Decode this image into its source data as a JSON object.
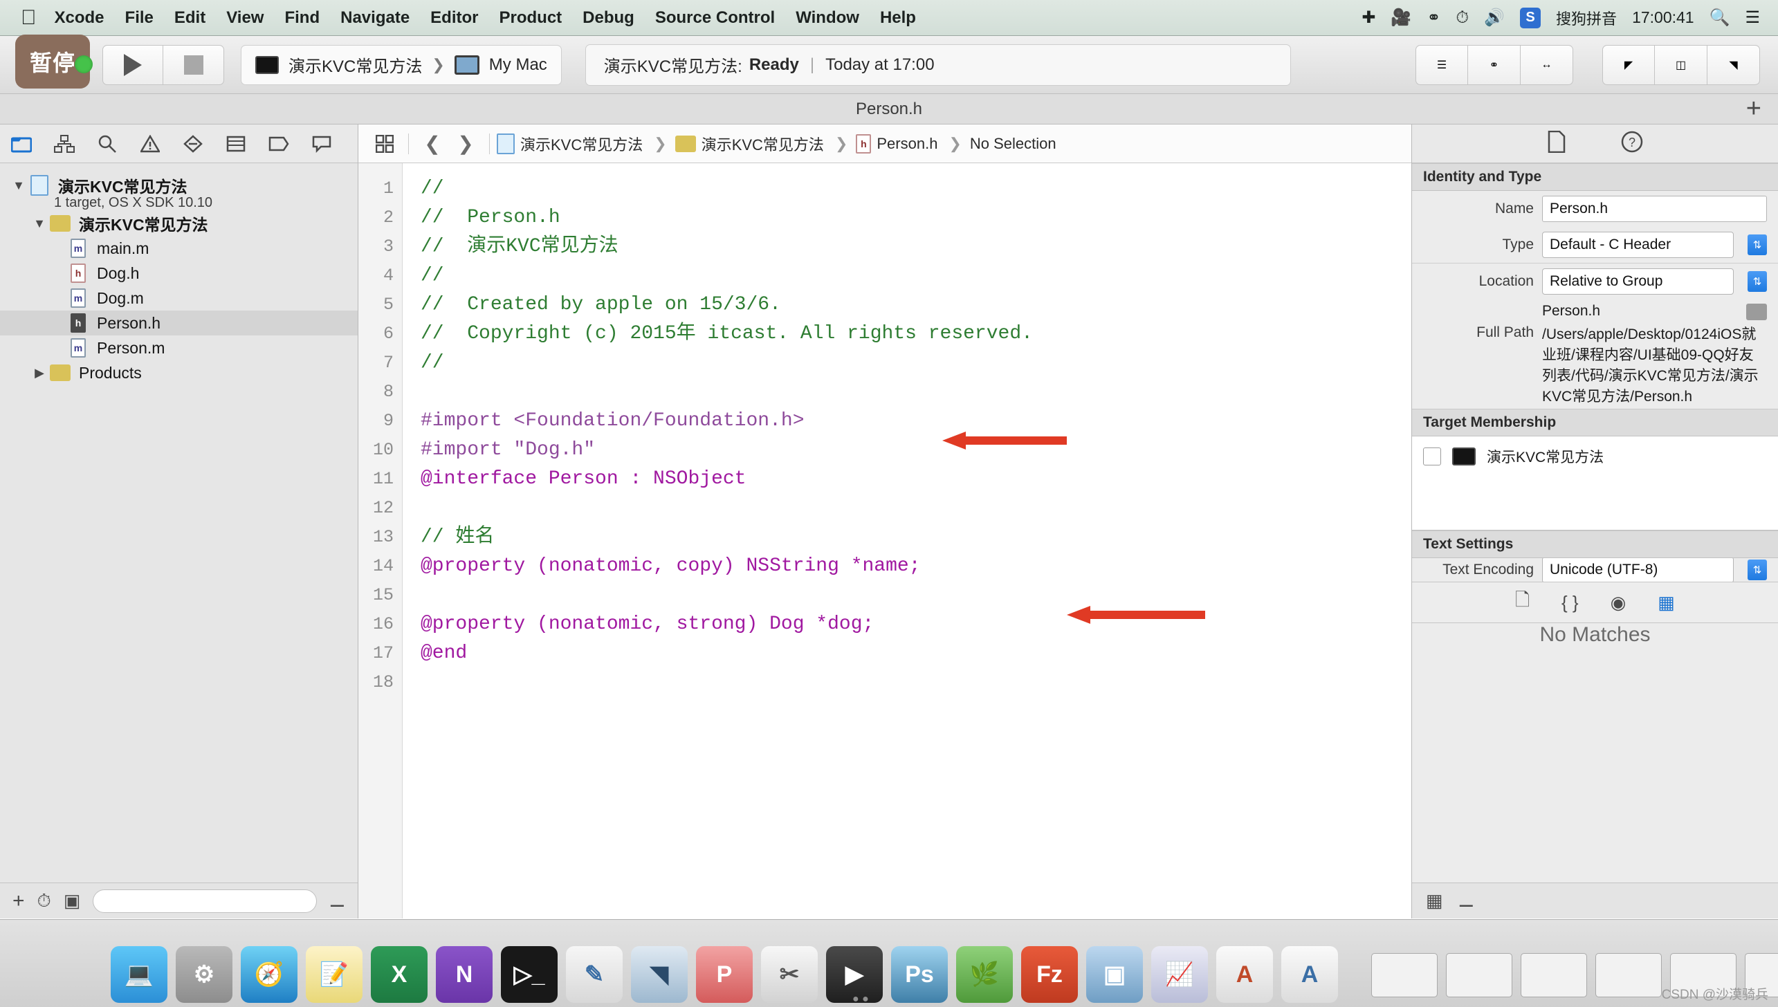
{
  "menubar": {
    "apple_icon": "apple-logo-icon",
    "items": [
      "Xcode",
      "File",
      "Edit",
      "View",
      "Find",
      "Navigate",
      "Editor",
      "Product",
      "Debug",
      "Source Control",
      "Window",
      "Help"
    ],
    "right_icons": [
      "airdrop-icon",
      "screen-record-icon",
      "bluetooth-icon",
      "time-machine-icon",
      "volume-icon"
    ],
    "input_badge": "S",
    "input_method": "搜狗拼音",
    "clock": "17:00:41",
    "search_icon": "search-icon",
    "notification_icon": "list-icon"
  },
  "toolbar": {
    "pause_label": "暂停",
    "run_icon": "play-icon",
    "stop_icon": "stop-icon",
    "scheme": "演示KVC常见方法",
    "scheme_separator": "❯",
    "destination": "My Mac",
    "status_project": "演示KVC常见方法:",
    "status_state": "Ready",
    "status_divider": "|",
    "status_time": "Today at 17:00",
    "right_buttons": [
      "standard-editor-icon",
      "assistant-editor-icon",
      "version-editor-icon",
      "navigator-toggle-icon",
      "debug-area-toggle-icon",
      "utilities-toggle-icon"
    ]
  },
  "titlebar": {
    "title": "Person.h",
    "add_icon": "plus-icon"
  },
  "navigator": {
    "tabs": [
      "project-navigator-icon",
      "symbol-navigator-icon",
      "search-navigator-icon",
      "issue-navigator-icon",
      "test-navigator-icon",
      "debug-navigator-icon",
      "breakpoint-navigator-icon",
      "report-navigator-icon"
    ],
    "project": {
      "name": "演示KVC常见方法",
      "subtitle": "1 target, OS X SDK 10.10"
    },
    "group": "演示KVC常见方法",
    "files": [
      {
        "name": "main.m",
        "kind": "m",
        "selected": false
      },
      {
        "name": "Dog.h",
        "kind": "h",
        "selected": false
      },
      {
        "name": "Dog.m",
        "kind": "m",
        "selected": false
      },
      {
        "name": "Person.h",
        "kind": "h",
        "selected": true
      },
      {
        "name": "Person.m",
        "kind": "m",
        "selected": false
      }
    ],
    "products": "Products",
    "footer": {
      "add_icon": "plus-icon",
      "recent_icon": "clock-icon",
      "sourcecontrol_icon": "source-control-icon",
      "filter_placeholder": "",
      "filter_value": ""
    }
  },
  "jumpbar": {
    "related_icon": "related-items-icon",
    "back_icon": "chevron-left-icon",
    "forward_icon": "chevron-right-icon",
    "crumbs": [
      "演示KVC常见方法",
      "演示KVC常见方法",
      "Person.h",
      "No Selection"
    ],
    "separator": "❯"
  },
  "editor": {
    "line_numbers": [
      1,
      2,
      3,
      4,
      5,
      6,
      7,
      8,
      9,
      10,
      11,
      12,
      13,
      14,
      15,
      16,
      17,
      18
    ],
    "lines": [
      "//",
      "//  Person.h",
      "//  演示KVC常见方法",
      "//",
      "//  Created by apple on 15/3/6.",
      "//  Copyright (c) 2015年 itcast. All rights reserved.",
      "//",
      "",
      "#import <Foundation/Foundation.h>",
      "#import \"Dog.h\"",
      "@interface Person : NSObject",
      "",
      "// 姓名",
      "@property (nonatomic, copy) NSString *name;",
      "",
      "@property (nonatomic, strong) Dog *dog;",
      "@end",
      ""
    ],
    "annotations": [
      {
        "name": "arrow-to-import-dog",
        "target_line": 10
      },
      {
        "name": "arrow-to-property-dog",
        "target_line": 16
      }
    ],
    "arrow_color": "#e03a24"
  },
  "inspector": {
    "tabs": [
      "file-inspector-icon",
      "quick-help-icon"
    ],
    "identity_section": "Identity and Type",
    "fields": [
      {
        "label": "Name",
        "value": "Person.h",
        "type": "text"
      },
      {
        "label": "Type",
        "value": "Default - C Header",
        "type": "popup"
      },
      {
        "label": "Location",
        "value": "Relative to Group",
        "type": "popup"
      }
    ],
    "location_file": "Person.h",
    "fullpath_label": "Full Path",
    "fullpath_value": "/Users/apple/Desktop/0124iOS就业班/课程内容/UI基础09-QQ好友列表/代码/演示KVC常见方法/演示KVC常见方法/Person.h",
    "target_membership_section": "Target Membership",
    "target_name": "演示KVC常见方法",
    "target_checked": false,
    "text_settings_section": "Text Settings",
    "text_encoding_label": "Text Encoding",
    "text_encoding_value": "Unicode (UTF-8)",
    "library_icons": [
      "file-template-library-icon",
      "code-snippet-library-icon",
      "object-library-icon",
      "media-library-icon"
    ],
    "library_selected": "media-library-icon",
    "no_matches": "No Matches",
    "footer_icons": [
      "library-grid-icon",
      "filter-icon"
    ]
  },
  "dock": {
    "items": [
      "finder-icon",
      "system-preferences-icon",
      "safari-icon",
      "notes-icon",
      "excel-icon",
      "onenote-icon",
      "terminal-icon",
      "sketch-icon",
      "navicat-icon",
      "prototype-icon",
      "snip-icon",
      "quicktime-icon",
      "photoshop-icon",
      "leaf-icon",
      "filezilla-icon",
      "xcode-sim-icon",
      "charts-icon",
      "font-book-icon",
      "preview-icon"
    ],
    "window_thumbs": 7,
    "trash": "trash-icon",
    "watermark": "CSDN @沙漠骑兵"
  }
}
